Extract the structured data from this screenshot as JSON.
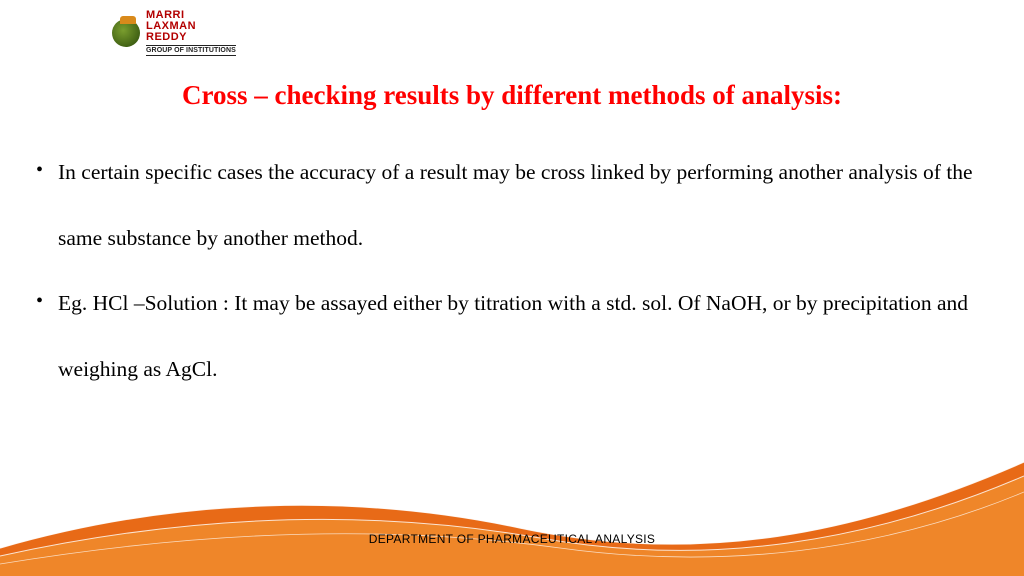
{
  "logo": {
    "line1": "MARRI",
    "line2": "LAXMAN",
    "line3": "REDDY",
    "sub": "GROUP OF INSTITUTIONS"
  },
  "title": "Cross – checking results by different methods of analysis:",
  "bullets": [
    "In certain specific cases the accuracy of a result may be cross linked by performing another analysis of the same substance by another method.",
    " Eg. HCl –Solution : It may be assayed either by titration with a std. sol. Of NaOH, or by precipitation and weighing as AgCl."
  ],
  "footer": "DEPARTMENT OF PHARMACEUTICAL ANALYSIS",
  "colors": {
    "title": "#ff0000",
    "wave1": "#e86a17",
    "wave2": "#f08a2b",
    "wave3": "#ffffff"
  }
}
